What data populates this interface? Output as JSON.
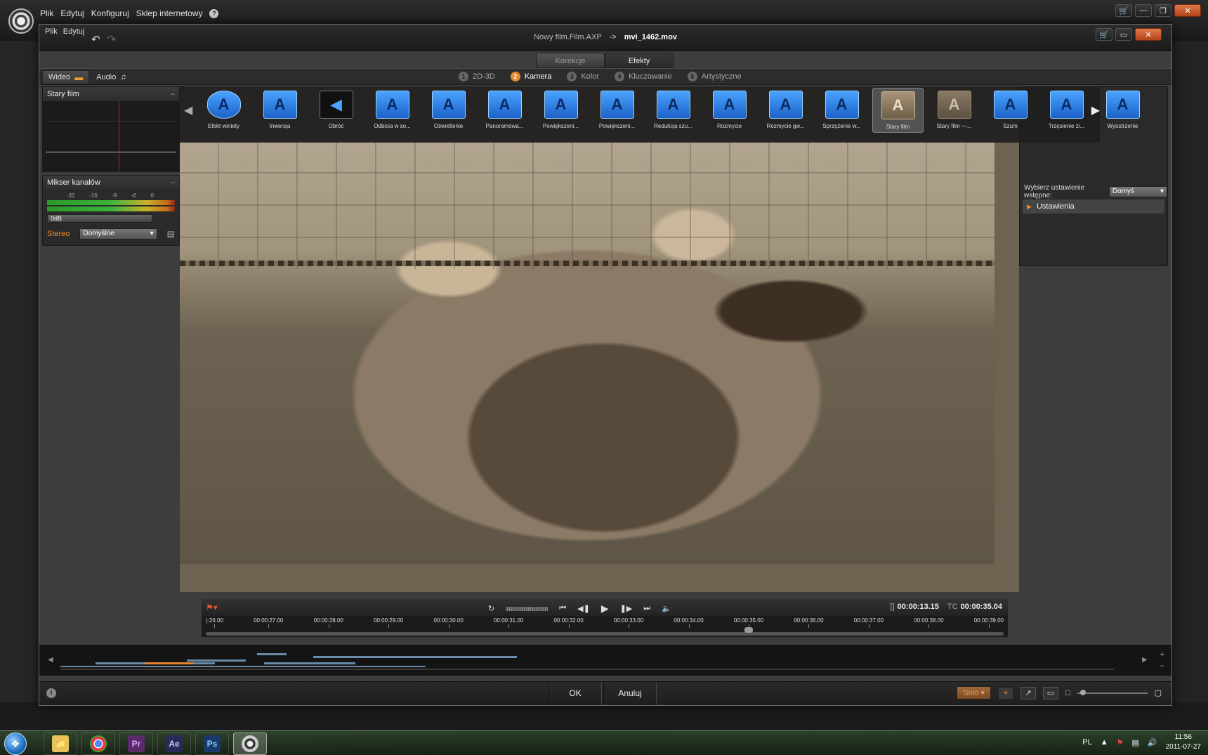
{
  "outer_app": {
    "menu": [
      "Plik",
      "Edytuj",
      "Konfiguruj",
      "Sklep internetowy"
    ],
    "help_icon": "?"
  },
  "dialog": {
    "menu": [
      "Plik",
      "Edytuj"
    ],
    "title_project": "Nowy film.Film.AXP",
    "title_separator": "->",
    "title_file": "mvi_1462.mov"
  },
  "main_tabs": [
    {
      "label": "Korekcje",
      "active": false
    },
    {
      "label": "Efekty",
      "active": true
    }
  ],
  "media_tabs": [
    {
      "label": "Wideo",
      "icon": "video-camera-icon",
      "active": true
    },
    {
      "label": "Audio",
      "icon": "music-note-icon",
      "active": false
    }
  ],
  "categories": [
    {
      "num": "1",
      "label": "2D-3D",
      "active": false
    },
    {
      "num": "2",
      "label": "Kamera",
      "active": true
    },
    {
      "num": "3",
      "label": "Kolor",
      "active": false
    },
    {
      "num": "4",
      "label": "Kluczowanie",
      "active": false
    },
    {
      "num": "5",
      "label": "Artystyczne",
      "active": false
    }
  ],
  "left_panel": {
    "effect_title": "Stary film",
    "mixer_title": "Mikser kanałów",
    "mixer_scale": [
      "-32",
      "-16",
      "-9",
      "-6",
      "0"
    ],
    "db_label": "0dB",
    "stereo_label": "Stereo",
    "stereo_value": "Domyślne"
  },
  "effects": [
    {
      "label": "Efekt winiety",
      "style": "round"
    },
    {
      "label": "Inwersja",
      "style": "blue"
    },
    {
      "label": "Obróć",
      "style": "dark"
    },
    {
      "label": "Odbicia w so...",
      "style": "blue"
    },
    {
      "label": "Oświetlenie",
      "style": "blue"
    },
    {
      "label": "Panoramowa...",
      "style": "blue"
    },
    {
      "label": "Powiększeni...",
      "style": "blue"
    },
    {
      "label": "Powiększeni...",
      "style": "blue"
    },
    {
      "label": "Redukcja szu...",
      "style": "blue"
    },
    {
      "label": "Rozmycie",
      "style": "blue"
    },
    {
      "label": "Rozmycie gw...",
      "style": "blue"
    },
    {
      "label": "Sprzężenie w...",
      "style": "blue"
    },
    {
      "label": "Stary film",
      "style": "sepia",
      "selected": true
    },
    {
      "label": "Stary film —...",
      "style": "sepia2"
    },
    {
      "label": "Szum",
      "style": "blue"
    },
    {
      "label": "Trzęsienie zi...",
      "style": "blue"
    },
    {
      "label": "Wyostrzenie",
      "style": "blue"
    }
  ],
  "right_panel": {
    "preset_label": "Wybierz ustawienie wstępne:",
    "preset_value": "Domyś",
    "settings_label": "Ustawienia"
  },
  "transport": {
    "in_out_tag": "[]",
    "position": "00:00:13.15",
    "tc_tag": "TC",
    "timecode": "00:00:35.04",
    "ruler": [
      "):26.00",
      "00:00:27.00",
      "00:00:28.00",
      "00:00:29.00",
      "00:00:30.00",
      "00:00:31.00",
      "00:00:32.00",
      "00:00:33.00",
      "00:00:34.00",
      "00:00:35.00",
      "00:00:36.00",
      "00:00:37.00",
      "00:00:38.00",
      "00:00:39.00"
    ]
  },
  "bottom": {
    "ok": "OK",
    "cancel": "Anuluj",
    "solo": "Solo"
  },
  "taskbar": {
    "apps": [
      {
        "name": "folder",
        "label": ""
      },
      {
        "name": "chrome",
        "label": ""
      },
      {
        "name": "premiere",
        "label": "Pr"
      },
      {
        "name": "after-effects",
        "label": "Ae"
      },
      {
        "name": "photoshop",
        "label": "Ps"
      },
      {
        "name": "pinnacle",
        "label": ""
      }
    ],
    "lang": "PL",
    "time": "11:56",
    "date": "2011-07-27"
  }
}
